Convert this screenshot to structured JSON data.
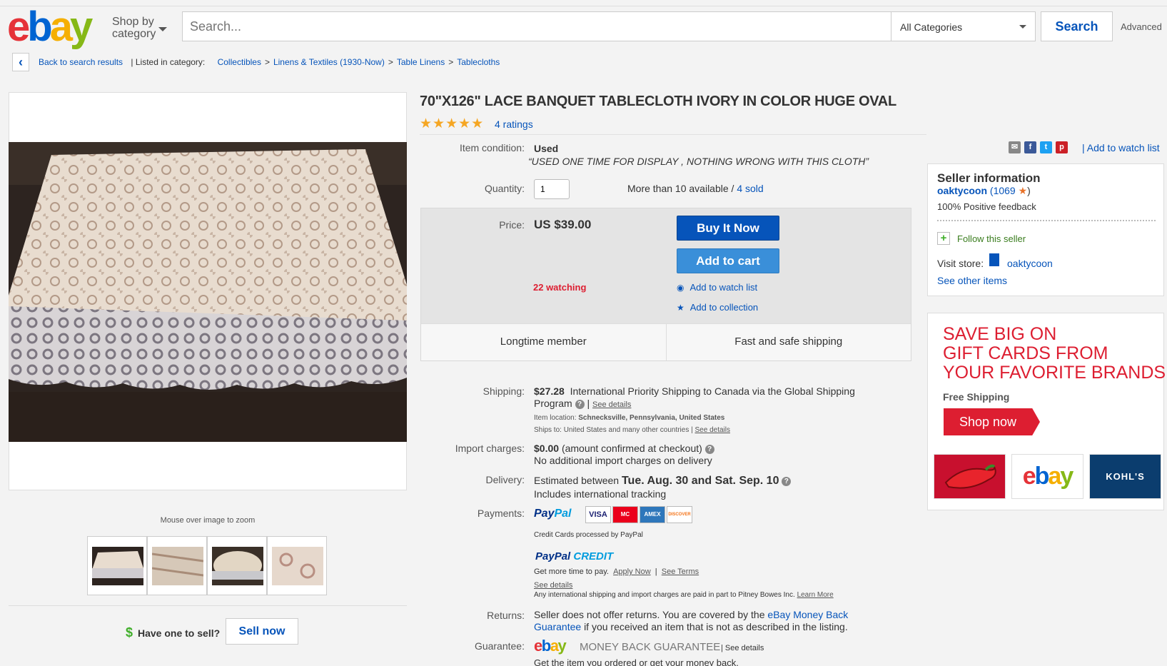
{
  "header": {
    "logo": [
      "e",
      "b",
      "a",
      "y"
    ],
    "shop_by": "Shop by",
    "category": "category",
    "search_placeholder": "Search...",
    "category_select": "All Categories",
    "search_button": "Search",
    "advanced": "Advanced"
  },
  "breadcrumb": {
    "back": "Back to search results",
    "listed_in": "| Listed in category:",
    "items": [
      "Collectibles",
      "Linens & Textiles (1930-Now)",
      "Table Linens",
      "Tablecloths"
    ],
    "separator": ">"
  },
  "gallery": {
    "zoom_hint": "Mouse over image to zoom",
    "thumb_count": 4
  },
  "sell": {
    "dollar": "$",
    "text": "Have one to sell?",
    "button": "Sell now"
  },
  "item": {
    "title": "70\"X126\" LACE BANQUET TABLECLOTH IVORY IN COLOR HUGE OVAL",
    "stars": "★★★★★",
    "star_rating": 5,
    "ratings": "4 ratings",
    "condition_label": "Item condition:",
    "condition": "Used",
    "condition_desc": "“USED ONE TIME FOR DISPLAY , NOTHING WRONG WITH THIS CLOTH”",
    "quantity_label": "Quantity:",
    "quantity": "1",
    "available": "More than 10 available /",
    "sold": "4 sold",
    "price_label": "Price:",
    "price": "US $39.00",
    "watching": "22 watching",
    "buy_now": "Buy It Now",
    "add_to_cart": "Add to cart",
    "add_watch": "Add to watch list",
    "add_collection": "Add to collection",
    "badge1": "Longtime member",
    "badge2": "Fast and safe shipping"
  },
  "details": {
    "shipping_label": "Shipping:",
    "shipping_price": "$27.28",
    "shipping_text": "International Priority Shipping to Canada  via the Global Shipping Program",
    "see_details": "See details",
    "item_location_label": "Item location:",
    "item_location": "Schnecksville, Pennsylvania, United States",
    "ships_to": "Ships to:  United States and many other countries |",
    "import_label": "Import charges:",
    "import_price": "$0.00",
    "import_text": "(amount confirmed at checkout)",
    "import_note": "No additional import charges on delivery",
    "delivery_label": "Delivery:",
    "delivery_prefix": "Estimated between",
    "delivery_dates": "Tue. Aug. 30 and Sat. Sep. 10",
    "delivery_note": "Includes international tracking",
    "payments_label": "Payments:",
    "paypal_a": "Pay",
    "paypal_b": "Pal",
    "cards": [
      "VISA",
      "MC",
      "AMEX",
      "DISCOVER"
    ],
    "cc_note": "Credit Cards processed by PayPal",
    "ppc_a": "PayPal",
    "ppc_b": "CREDIT",
    "ppc_text": "Get more time to pay.",
    "apply_now": "Apply Now",
    "see_terms": "See Terms",
    "ppc_details": "See details",
    "intl_note": "Any international shipping and import charges are paid in part to Pitney Bowes Inc.",
    "learn_more": "Learn More",
    "returns_label": "Returns:",
    "returns_a": "Seller does not offer returns. You are covered by the",
    "returns_link": "eBay Money Back Guarantee",
    "returns_b": "if you received an item that is not as described in the listing.",
    "guarantee_label": "Guarantee:",
    "guarantee_text": "MONEY BACK GUARANTEE",
    "guarantee_see": "| See details",
    "guarantee_sub": "Get the item you ordered or get your money back."
  },
  "share": {
    "watch": "| Add to watch list"
  },
  "seller": {
    "heading": "Seller information",
    "name": "oaktycoon",
    "score": "(1069",
    "score_close": ")",
    "feedback": "100% Positive feedback",
    "follow": "Follow this seller",
    "visit": "Visit store:",
    "store": "oaktycoon",
    "other": "See other items"
  },
  "ad": {
    "line1": "SAVE BIG ON",
    "line2": "GIFT CARDS FROM",
    "line3": "YOUR FAVORITE BRANDS",
    "free": "Free Shipping",
    "button": "Shop now",
    "kohls": "KOHL'S"
  }
}
